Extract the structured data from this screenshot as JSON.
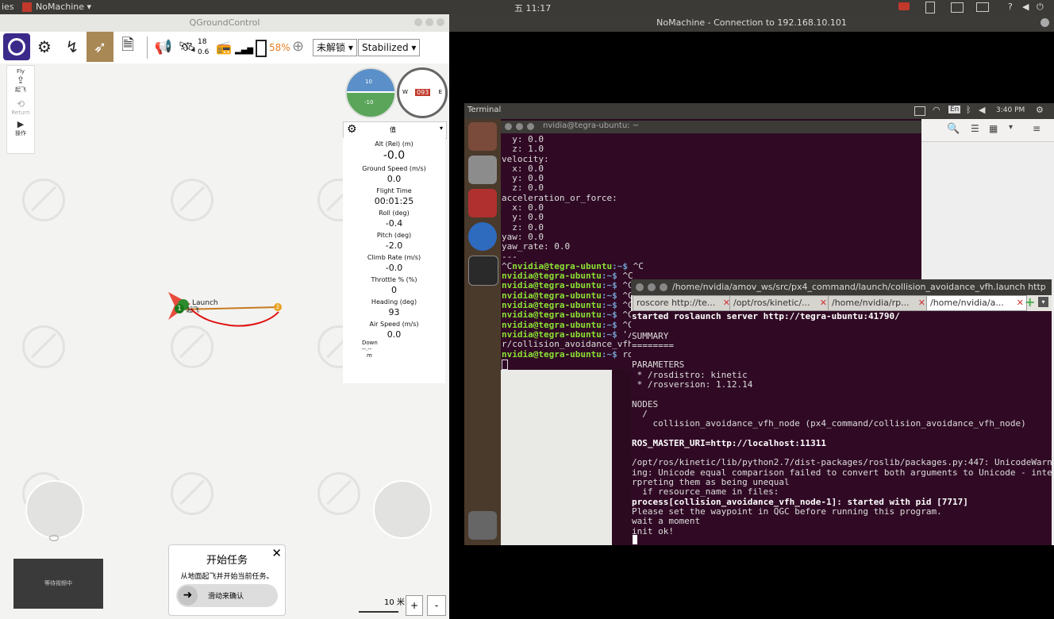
{
  "topbar": {
    "left_text": "ies",
    "app_menu": "NoMachine",
    "clock": "五 11:17"
  },
  "qgc": {
    "window_title": "QGroundControl",
    "toolbar": {
      "sat_count": "18",
      "hdop": "0.6",
      "battery": "58%",
      "arm_status": "未解锁",
      "flight_mode": "Stabilized"
    },
    "left_tools": [
      {
        "label": "Fly"
      },
      {
        "label": "起飞"
      },
      {
        "label": "Return"
      },
      {
        "label": "操作"
      }
    ],
    "attitude": {
      "pitch_top": "10",
      "pitch_bottom": "-10",
      "heading": "093",
      "compass_w": "W",
      "compass_e": "E"
    },
    "values_header": "值",
    "values": [
      {
        "label": "Alt (Rel) (m)",
        "value": "-0.0"
      },
      {
        "label": "Ground Speed (m/s)",
        "value": "0.0"
      },
      {
        "label": "Flight Time",
        "value": "00:01:25"
      },
      {
        "label": "Roll (deg)",
        "value": "-0.4"
      },
      {
        "label": "Pitch (deg)",
        "value": "-2.0"
      },
      {
        "label": "Climb Rate (m/s)",
        "value": "-0.0"
      },
      {
        "label": "Throttle % (%)",
        "value": "0"
      },
      {
        "label": "Heading (deg)",
        "value": "93"
      },
      {
        "label": "Air Speed (m/s)",
        "value": "0.0"
      }
    ],
    "down": {
      "label": "Down",
      "value": "--.--",
      "unit": "m"
    },
    "map": {
      "launch_label": "Launch",
      "wp1": "1",
      "wp2": "2",
      "wp1_label": "起飞"
    },
    "video": "等待视频中",
    "mission": {
      "title": "开始任务",
      "desc": "从地面起飞并开始当前任务。",
      "slider": "滑动来确认"
    },
    "scale": "10 米",
    "zoom_in": "+",
    "zoom_out": "-"
  },
  "nomachine": {
    "window_title": "NoMachine - Connection to 192.168.10.101"
  },
  "remote": {
    "terminal_bar_title": "Terminal",
    "clock": "3:40 PM",
    "lang": "En",
    "term1_title": "nvidia@tegra-ubuntu: ~",
    "term1_lines": [
      "  y: 0.0",
      "  z: 1.0",
      "velocity:",
      "  x: 0.0",
      "  y: 0.0",
      "  z: 0.0",
      "acceleration_or_force:",
      "  x: 0.0",
      "  y: 0.0",
      "  z: 0.0",
      "yaw: 0.0",
      "yaw_rate: 0.0",
      "---"
    ],
    "prompt": "nvidia@tegra-ubuntu",
    "prompt_lines": [
      {
        "pre": "^C",
        "path": ":~$",
        "cmd": " ^C"
      },
      {
        "pre": "",
        "path": ":~$",
        "cmd": " ^C"
      },
      {
        "pre": "",
        "path": ":~$",
        "cmd": " ^C"
      },
      {
        "pre": "",
        "path": ":~$",
        "cmd": " ^C"
      },
      {
        "pre": "",
        "path": ":~$",
        "cmd": " ^C"
      },
      {
        "pre": "",
        "path": ":~$",
        "cmd": " ^C"
      },
      {
        "pre": "",
        "path": ":~$",
        "cmd": " ^C"
      },
      {
        "pre": "",
        "path": ":~$",
        "cmd": " '/"
      }
    ],
    "term1_wrap": "r/collision_avoidance_vfh",
    "term1_last": {
      "path": ":~$",
      "cmd": " ro"
    },
    "term2_title": "/home/nvidia/amov_ws/src/px4_command/launch/collision_avoidance_vfh.launch http://",
    "tabs": [
      "roscore http://te...",
      "/opt/ros/kinetic/...",
      "/home/nvidia/rp...",
      "/home/nvidia/a..."
    ],
    "term2_lines": [
      {
        "t": "started roslaunch server http://tegra-ubuntu:41790/",
        "b": true
      },
      {
        "t": "",
        "b": false
      },
      {
        "t": "SUMMARY",
        "b": false
      },
      {
        "t": "========",
        "b": false
      },
      {
        "t": "",
        "b": false
      },
      {
        "t": "PARAMETERS",
        "b": false
      },
      {
        "t": " * /rosdistro: kinetic",
        "b": false
      },
      {
        "t": " * /rosversion: 1.12.14",
        "b": false
      },
      {
        "t": "",
        "b": false
      },
      {
        "t": "NODES",
        "b": false
      },
      {
        "t": "  /",
        "b": false
      },
      {
        "t": "    collision_avoidance_vfh_node (px4_command/collision_avoidance_vfh_node)",
        "b": false
      },
      {
        "t": "",
        "b": false
      },
      {
        "t": "ROS_MASTER_URI=http://localhost:11311",
        "b": true
      },
      {
        "t": "",
        "b": false
      },
      {
        "t": "/opt/ros/kinetic/lib/python2.7/dist-packages/roslib/packages.py:447: UnicodeWarn",
        "b": false
      },
      {
        "t": "ing: Unicode equal comparison failed to convert both arguments to Unicode - inte",
        "b": false
      },
      {
        "t": "rpreting them as being unequal",
        "b": false
      },
      {
        "t": "  if resource_name in files:",
        "b": false
      },
      {
        "t": "process[collision_avoidance_vfh_node-1]: started with pid [7717]",
        "b": true
      },
      {
        "t": "Please set the waypoint in QGC before running this program.",
        "b": false
      },
      {
        "t": "wait a moment",
        "b": false
      },
      {
        "t": "init ok!",
        "b": false
      }
    ]
  }
}
